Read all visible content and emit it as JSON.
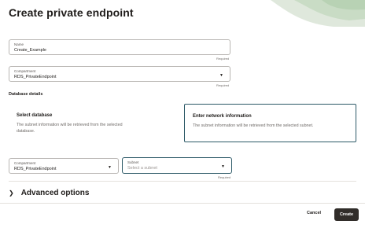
{
  "header": {
    "title": "Create private endpoint"
  },
  "name_field": {
    "label": "Name",
    "value": "Create_Example",
    "required": "Required"
  },
  "compartment_field": {
    "label": "Compartment",
    "value": "RDS_PrivateEndpoint",
    "required": "Required"
  },
  "database_details": {
    "label": "Database details"
  },
  "options": {
    "select_database": {
      "title": "Select database",
      "description_line1": "The subnet information will be retrieved from the selected",
      "description_line2": "database."
    },
    "network_info": {
      "title": "Enter network information",
      "description": "The subnet information will be retrieved from the selected subnet."
    }
  },
  "network": {
    "compartment": {
      "label": "Compartment",
      "value": "RDS_PrivateEndpoint"
    },
    "subnet": {
      "label": "Subnet",
      "placeholder": "Select a subnet",
      "required": "Required"
    }
  },
  "advanced": {
    "label": "Advanced options"
  },
  "footer": {
    "cancel_label": "Cancel",
    "create_label": "Create"
  },
  "colors": {
    "accent": "#2c5967",
    "primary_button": "#312d2a"
  }
}
